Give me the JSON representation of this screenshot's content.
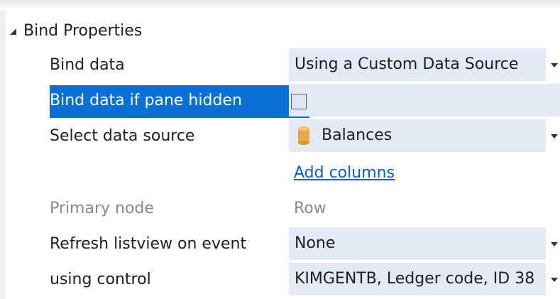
{
  "section": {
    "title": "Bind Properties",
    "collapse_icon": "triangle-expanded-icon"
  },
  "rows": {
    "bind_data": {
      "label": "Bind data",
      "value": "Using a Custom Data Source"
    },
    "bind_if_hidden": {
      "label": "Bind data if pane hidden",
      "checked": false
    },
    "select_source": {
      "label": "Select data source",
      "value": "Balances",
      "icon": "database-icon"
    },
    "add_columns": {
      "link": "Add columns"
    },
    "primary_node": {
      "label": "Primary node",
      "value": "Row"
    },
    "refresh_event": {
      "label": "Refresh listview on event",
      "value": "None"
    },
    "using_control": {
      "label": "using control",
      "value": "KIMGENTB, Ledger code, ID 38"
    }
  },
  "colors": {
    "selection": "#0a6fd6",
    "value_cell": "#e4e9f6",
    "link": "#0a5fcc",
    "muted_text": "#8a8a8a",
    "db_icon": "#e8a94a"
  }
}
